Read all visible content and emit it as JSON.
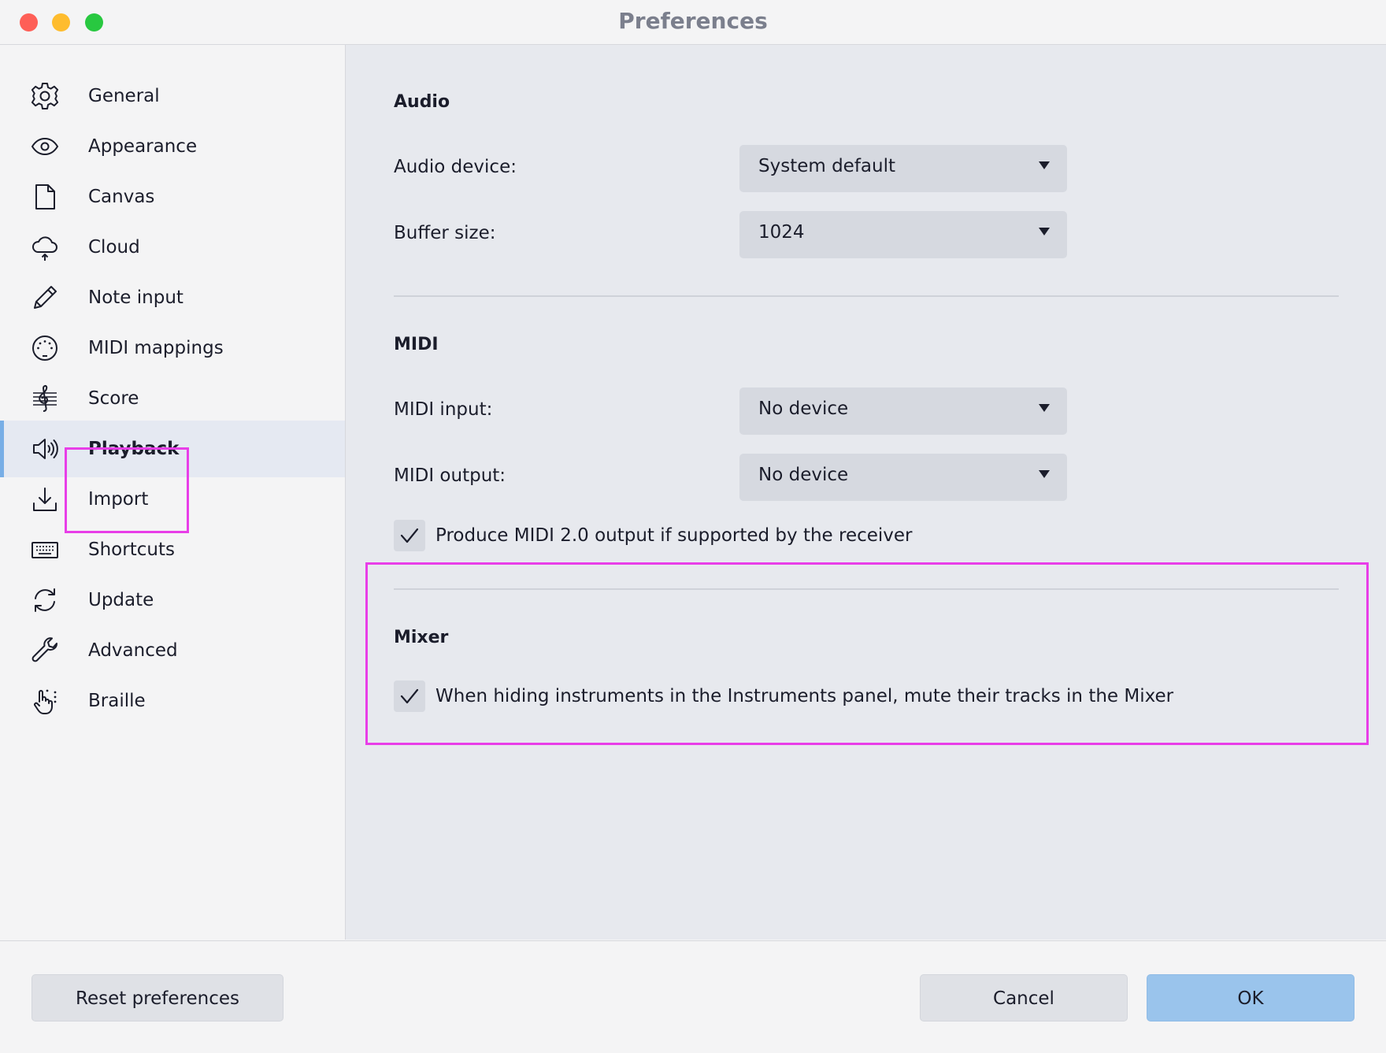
{
  "window": {
    "title": "Preferences"
  },
  "sidebar": {
    "items": [
      {
        "label": "General",
        "icon": "gear-icon"
      },
      {
        "label": "Appearance",
        "icon": "eye-icon"
      },
      {
        "label": "Canvas",
        "icon": "document-icon"
      },
      {
        "label": "Cloud",
        "icon": "cloud-icon"
      },
      {
        "label": "Note input",
        "icon": "pencil-icon"
      },
      {
        "label": "MIDI mappings",
        "icon": "midi-connector-icon"
      },
      {
        "label": "Score",
        "icon": "treble-clef-icon"
      },
      {
        "label": "Playback",
        "icon": "speaker-icon",
        "selected": true
      },
      {
        "label": "Import",
        "icon": "download-icon"
      },
      {
        "label": "Shortcuts",
        "icon": "keyboard-icon"
      },
      {
        "label": "Update",
        "icon": "refresh-icon"
      },
      {
        "label": "Advanced",
        "icon": "wrench-icon"
      },
      {
        "label": "Braille",
        "icon": "braille-hand-icon"
      }
    ]
  },
  "audio": {
    "title": "Audio",
    "device_label": "Audio device:",
    "device_value": "System default",
    "buffer_label": "Buffer size:",
    "buffer_value": "1024"
  },
  "midi": {
    "title": "MIDI",
    "input_label": "MIDI input:",
    "input_value": "No device",
    "output_label": "MIDI output:",
    "output_value": "No device",
    "midi2_label": "Produce MIDI 2.0 output if supported by the receiver",
    "midi2_checked": true
  },
  "mixer": {
    "title": "Mixer",
    "mute_label": "When hiding instruments in the Instruments panel, mute their tracks in the Mixer",
    "mute_checked": true
  },
  "footer": {
    "reset_label": "Reset preferences",
    "cancel_label": "Cancel",
    "ok_label": "OK"
  },
  "colors": {
    "accent": "#78aee6",
    "highlight": "#e83ee8",
    "primary_button": "#9ac4ec"
  }
}
